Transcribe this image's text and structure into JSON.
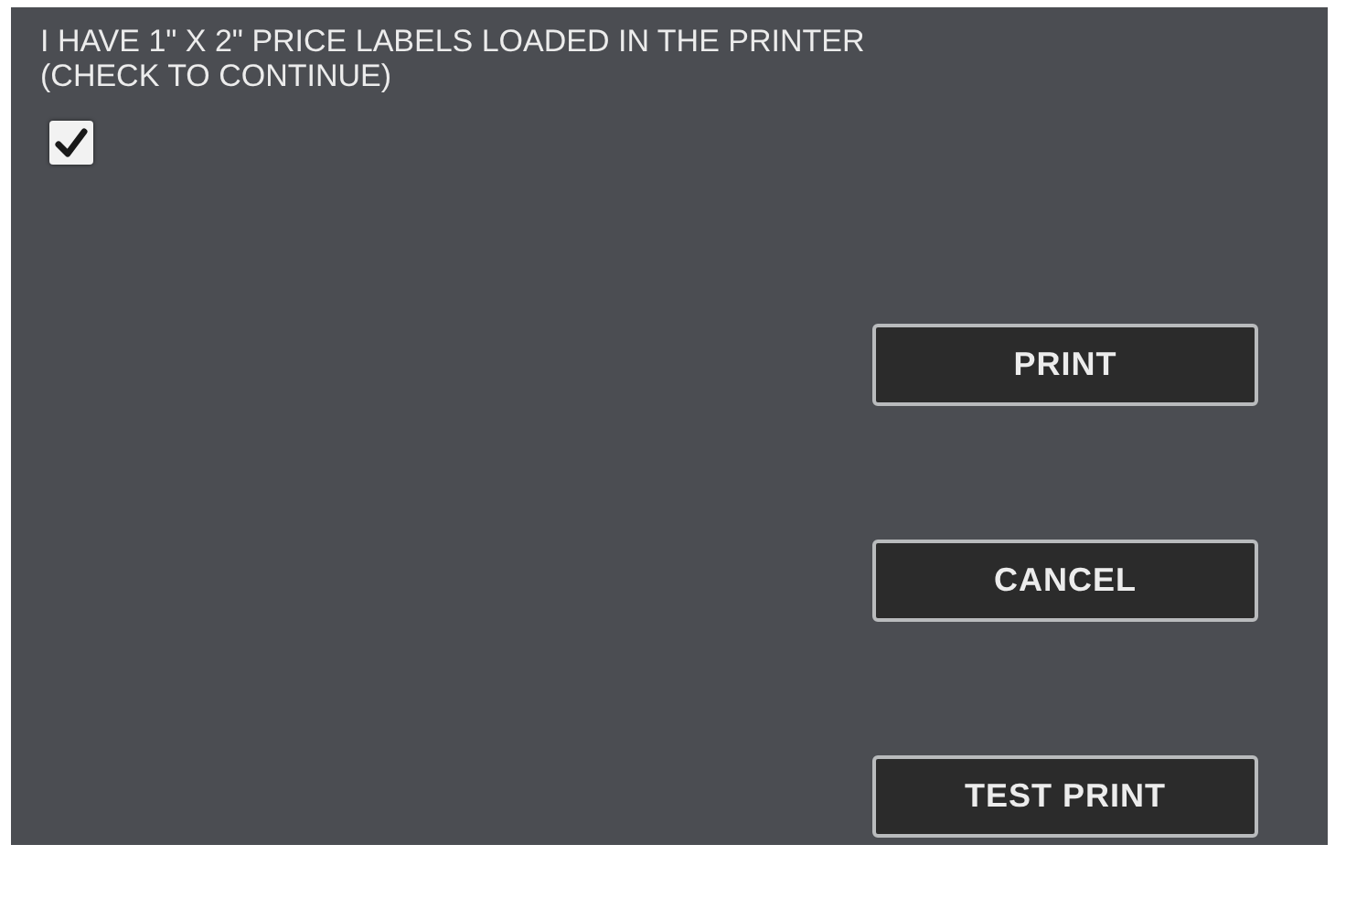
{
  "prompt_lines": [
    "I HAVE 1\" X 2\" PRICE LABELS LOADED IN THE PRINTER",
    "(CHECK TO CONTINUE)"
  ],
  "confirm": {
    "checked": true
  },
  "buttons": [
    {
      "label": "PRINT"
    },
    {
      "label": "CANCEL"
    },
    {
      "label": "TEST PRINT"
    }
  ]
}
